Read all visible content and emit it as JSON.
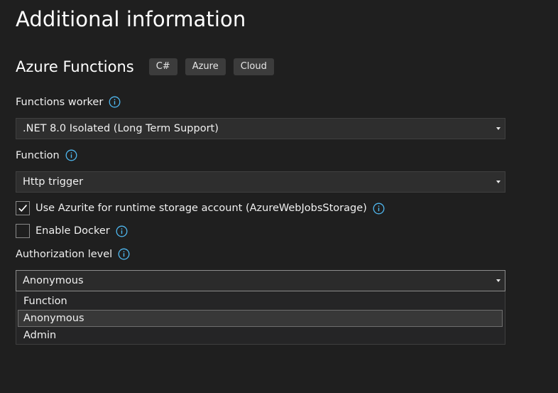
{
  "page_title": "Additional information",
  "project": {
    "name": "Azure Functions",
    "tags": [
      "C#",
      "Azure",
      "Cloud"
    ]
  },
  "functions_worker": {
    "label": "Functions worker",
    "value": ".NET 8.0 Isolated (Long Term Support)"
  },
  "function": {
    "label": "Function",
    "value": "Http trigger"
  },
  "use_azurite": {
    "label": "Use Azurite for runtime storage account (AzureWebJobsStorage)",
    "checked": true
  },
  "enable_docker": {
    "label": "Enable Docker",
    "checked": false
  },
  "authorization_level": {
    "label": "Authorization level",
    "value": "Anonymous",
    "options": [
      "Function",
      "Anonymous",
      "Admin"
    ],
    "highlighted_option": "Anonymous"
  },
  "colors": {
    "background": "#1f1f1f",
    "info_icon": "#4fb8f0",
    "tag_background": "#3c3c3c"
  },
  "icons": {
    "info": "info-circle-icon",
    "dropdown": "chevron-down-icon",
    "check": "checkmark-icon"
  }
}
